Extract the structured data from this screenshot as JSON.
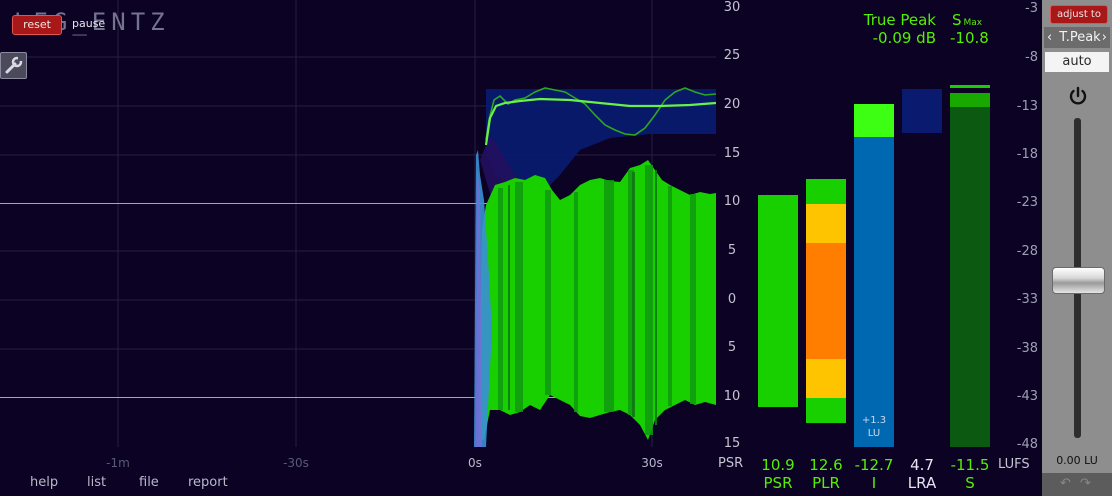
{
  "app": {
    "logo": "LEG_ENTZ"
  },
  "controls": {
    "reset": "reset",
    "pause": "pause",
    "tool_icon": "wrench-icon"
  },
  "graph": {
    "y_ticks": [
      "30",
      "25",
      "20",
      "15",
      "10",
      "5",
      "0",
      "5",
      "10",
      "15"
    ],
    "x_ticks": [
      "-1m",
      "-30s",
      "0s",
      "30s"
    ],
    "psr_label": "PSR"
  },
  "true_peak": {
    "label": "True Peak",
    "value": "-0.09 dB"
  },
  "smax": {
    "label": "S",
    "sub": "Max",
    "value": "-10.8"
  },
  "meters": [
    {
      "value": "10.9",
      "label": "PSR"
    },
    {
      "value": "12.6",
      "label": "PLR"
    },
    {
      "value": "-12.7",
      "label": "I"
    },
    {
      "value": "4.7",
      "label": "LRA"
    },
    {
      "value": "-11.5",
      "label": "S"
    }
  ],
  "meter_i_note": {
    "delta": "+1.3",
    "unit": "LU"
  },
  "lufs_scale": {
    "ticks": [
      "-3",
      "-8",
      "-13",
      "-18",
      "-23",
      "-28",
      "-33",
      "-38",
      "-43",
      "-48"
    ],
    "unit": "LUFS"
  },
  "right_panel": {
    "adjust_to": "adjust to",
    "target": "T.Peak",
    "mode": "auto",
    "power_icon": "power-icon",
    "gain": "0.00 LU",
    "undo_icon": "undo-icon",
    "redo_icon": "redo-icon"
  },
  "menu": [
    "help",
    "list",
    "file",
    "report"
  ],
  "colors": {
    "background": "#0b0224",
    "green": "#18cf00",
    "text_green": "#54f000",
    "blue": "#0068b0",
    "orange": "#ff7e00",
    "yellow": "#ffc400",
    "navy": "#0a1a6e"
  }
}
